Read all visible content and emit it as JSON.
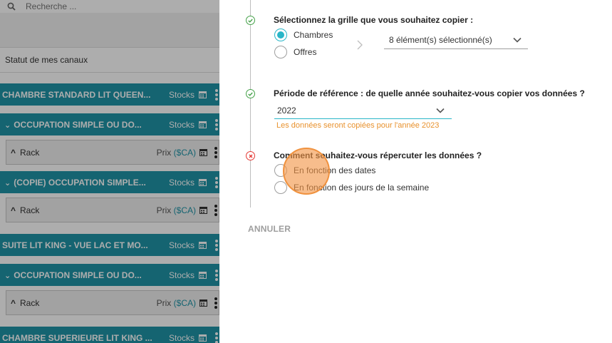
{
  "left": {
    "search": {
      "placeholder": "Recherche ..."
    },
    "status_label": "Statut de mes canaux",
    "rows": [
      {
        "kind": "room",
        "name": "CHAMBRE STANDARD LIT QUEEN...",
        "meta": "Stocks"
      },
      {
        "kind": "room",
        "name": "OCCUPATION SIMPLE OU DO...",
        "meta": "Stocks",
        "expanded": true
      },
      {
        "kind": "rate",
        "name": "Rack",
        "prix": "Prix",
        "currency": "($CA)"
      },
      {
        "kind": "room",
        "name": "(COPIE) OCCUPATION SIMPLE...",
        "meta": "Stocks",
        "expanded": true
      },
      {
        "kind": "rate",
        "name": "Rack",
        "prix": "Prix",
        "currency": "($CA)"
      },
      {
        "kind": "room",
        "name": "SUITE LIT KING - VUE LAC ET MO...",
        "meta": "Stocks"
      },
      {
        "kind": "room",
        "name": "OCCUPATION SIMPLE OU DO...",
        "meta": "Stocks",
        "expanded": true
      },
      {
        "kind": "rate",
        "name": "Rack",
        "prix": "Prix",
        "currency": "($CA)"
      },
      {
        "kind": "room",
        "name": "CHAMBRE SUPERIEURE LIT KING ...",
        "meta": "Stocks"
      }
    ]
  },
  "dialog": {
    "step1": {
      "question": "Sélectionnez la grille que vous souhaitez copier :",
      "options": [
        "Chambres",
        "Offres"
      ],
      "selected": "Chambres",
      "selection_summary": "8 élément(s) sélectionné(s)"
    },
    "step2": {
      "question": "Période de référence : de quelle année souhaitez-vous copier vos données ?",
      "year": "2022",
      "hint": "Les données seront copiées pour l'année 2023"
    },
    "step3": {
      "question": "Comment souhaitez-vous répercuter les données ?",
      "options": [
        "En fonction des dates",
        "En fonction des jours de la semaine"
      ]
    },
    "cancel_label": "ANNULER"
  },
  "colors": {
    "teal_row": "#1f94a7",
    "accent": "#29b6c8",
    "success": "#43a047",
    "error": "#e53935",
    "hint": "#e8912d"
  }
}
